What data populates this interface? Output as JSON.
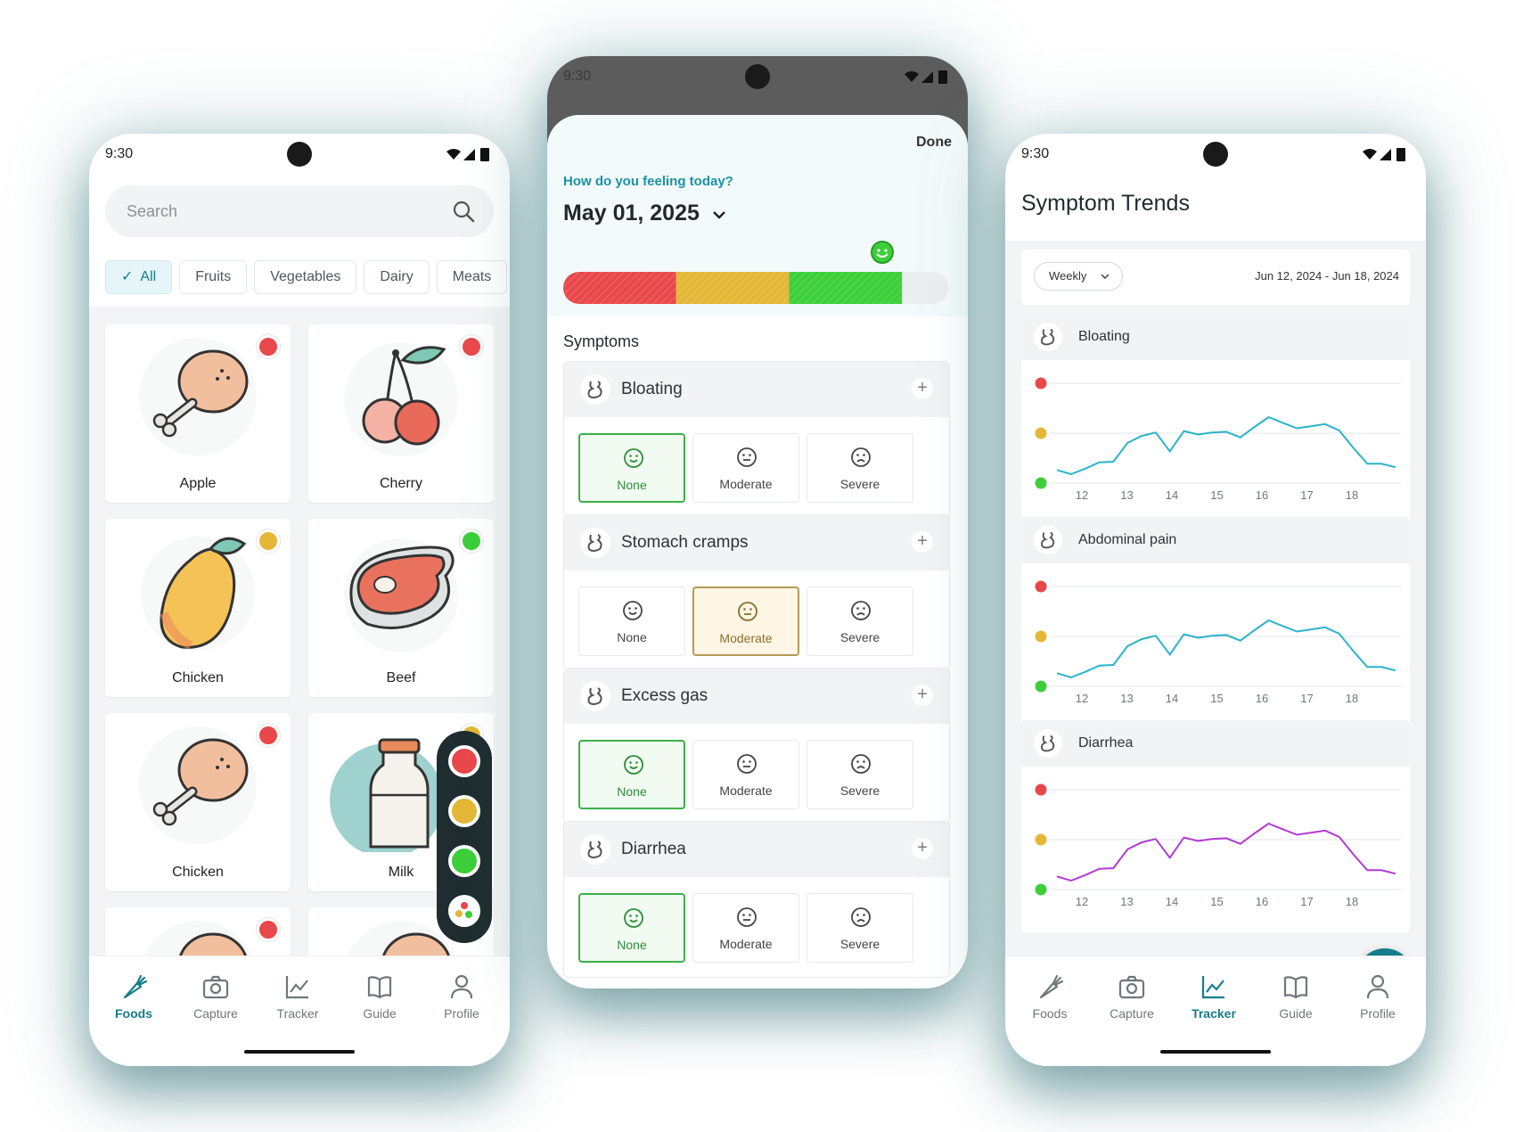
{
  "status": {
    "time": "9:30"
  },
  "colors": {
    "accent": "#157c8b",
    "red": "#e8484b",
    "yellow": "#e4b737",
    "green": "#3ccf3a",
    "chart_line": "#2ab3c9",
    "chart_line_alt": "#b13ad4"
  },
  "foods_screen": {
    "search": {
      "placeholder": "Search",
      "icon": "search-icon"
    },
    "chips": [
      {
        "label": "All",
        "active": true
      },
      {
        "label": "Fruits",
        "active": false
      },
      {
        "label": "Vegetables",
        "active": false
      },
      {
        "label": "Dairy",
        "active": false
      },
      {
        "label": "Meats",
        "active": false
      }
    ],
    "foods": [
      {
        "name": "Apple",
        "rating": "red",
        "icon": "drumstick"
      },
      {
        "name": "Cherry",
        "rating": "red",
        "icon": "cherry"
      },
      {
        "name": "Chicken",
        "rating": "yellow",
        "icon": "mango"
      },
      {
        "name": "Beef",
        "rating": "green",
        "icon": "steak"
      },
      {
        "name": "Chicken",
        "rating": "red",
        "icon": "drumstick"
      },
      {
        "name": "Milk",
        "rating": "yellow",
        "icon": "milk"
      },
      {
        "name": "",
        "rating": "red",
        "icon": "drumstick"
      },
      {
        "name": "",
        "rating": "",
        "icon": "drumstick"
      }
    ],
    "rating_filter": [
      "red",
      "yellow",
      "green",
      "all"
    ]
  },
  "nav": [
    {
      "label": "Foods",
      "icon": "carrot-icon"
    },
    {
      "label": "Capture",
      "icon": "camera-icon"
    },
    {
      "label": "Tracker",
      "icon": "chart-icon"
    },
    {
      "label": "Guide",
      "icon": "book-icon"
    },
    {
      "label": "Profile",
      "icon": "person-icon"
    }
  ],
  "log_screen": {
    "done_label": "Done",
    "question": "How do you feeling today?",
    "date": "May 01, 2025",
    "feeling_level": 0.88,
    "symptoms_title": "Symptoms",
    "symptoms": [
      {
        "name": "Bloating",
        "selected": "None"
      },
      {
        "name": "Stomach cramps",
        "selected": "Moderate"
      },
      {
        "name": "Excess gas",
        "selected": "None"
      },
      {
        "name": "Diarrhea",
        "selected": "None"
      }
    ],
    "severity_options": [
      "None",
      "Moderate",
      "Severe"
    ]
  },
  "trends_screen": {
    "title": "Symptom Trends",
    "period": "Weekly",
    "date_range": "Jun 12, 2024 - Jun 18, 2024",
    "x_ticks": [
      "12",
      "13",
      "14",
      "15",
      "16",
      "17",
      "18"
    ],
    "charts": [
      {
        "name": "Bloating",
        "color": "#2ab3c9",
        "values": [
          0.06,
          0.0,
          0.08,
          0.17,
          0.18,
          0.45,
          0.55,
          0.6,
          0.33,
          0.62,
          0.57,
          0.6,
          0.61,
          0.53,
          0.68,
          0.82,
          0.74,
          0.66,
          0.69,
          0.72,
          0.63,
          0.38,
          0.15,
          0.15,
          0.1
        ]
      },
      {
        "name": "Abdominal pain",
        "color": "#2ab3c9",
        "values": [
          0.06,
          0.0,
          0.08,
          0.17,
          0.18,
          0.45,
          0.55,
          0.6,
          0.33,
          0.62,
          0.57,
          0.6,
          0.61,
          0.53,
          0.68,
          0.82,
          0.74,
          0.66,
          0.69,
          0.72,
          0.63,
          0.38,
          0.15,
          0.15,
          0.1
        ]
      },
      {
        "name": "Diarrhea",
        "color": "#b13ad4",
        "values": [
          0.06,
          0.0,
          0.08,
          0.17,
          0.18,
          0.45,
          0.55,
          0.6,
          0.33,
          0.62,
          0.57,
          0.6,
          0.61,
          0.53,
          0.68,
          0.82,
          0.74,
          0.66,
          0.69,
          0.72,
          0.63,
          0.38,
          0.15,
          0.15,
          0.1
        ]
      }
    ]
  }
}
